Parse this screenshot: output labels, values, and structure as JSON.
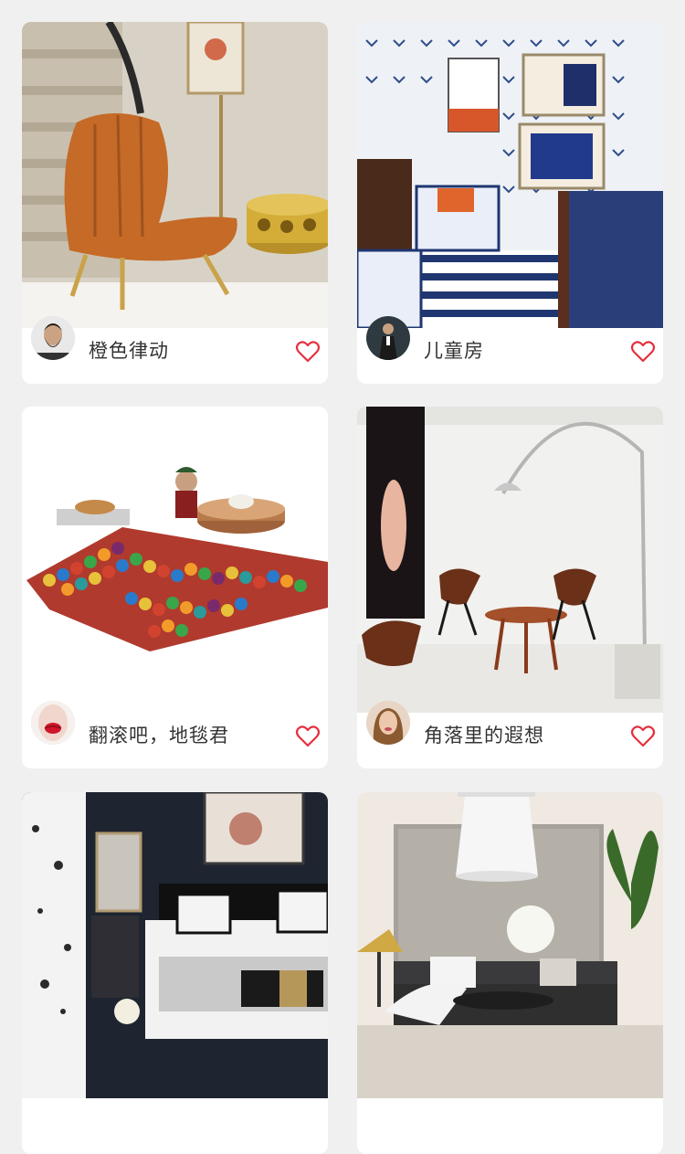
{
  "colors": {
    "background": "#f0f0f0",
    "card": "#ffffff",
    "title_text": "#333333",
    "heart": "#e5303e"
  },
  "cards": [
    {
      "title": "橙色律动",
      "avatar": "bearded-man-avatar",
      "image": "orange-lounge-chair-photo",
      "favorite_icon": "heart-outline-icon"
    },
    {
      "title": "儿童房",
      "avatar": "man-in-suit-avatar",
      "image": "nautical-kids-room-photo",
      "favorite_icon": "heart-outline-icon"
    },
    {
      "title": "翻滚吧，地毯君",
      "avatar": "red-lips-avatar",
      "image": "pom-pom-rug-photo",
      "favorite_icon": "heart-outline-icon"
    },
    {
      "title": "角落里的遐想",
      "avatar": "woman-portrait-avatar",
      "image": "arc-lamp-corner-photo",
      "favorite_icon": "heart-outline-icon"
    },
    {
      "title": "",
      "avatar": "",
      "image": "dark-bedroom-photo",
      "favorite_icon": ""
    },
    {
      "title": "",
      "avatar": "",
      "image": "living-room-pendant-photo",
      "favorite_icon": ""
    }
  ]
}
